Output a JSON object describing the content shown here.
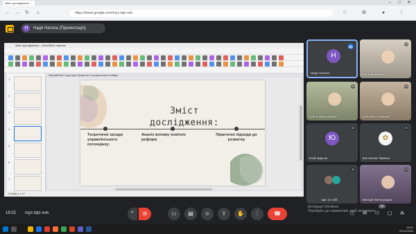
{
  "browser": {
    "tab_title": "Зміст дослідження",
    "url": "https://meet.google.com/myz-tqtz-xvb"
  },
  "meet": {
    "presenter_label": "Надя Нагола (Презентація)",
    "presenter_initial": "Н",
    "meeting_time": "19:02",
    "meeting_code": "myz-tqtz-xvb",
    "people_count": "23"
  },
  "ppt": {
    "window_title": "Зміст дослідження - LibreOffice Impress",
    "notes_tabs": "Звичайний  Структура  Примітки  Сортувальник слайдів",
    "status_text": "Слайд 4 з 12",
    "slide_numbers": [
      "1",
      "2",
      "3",
      "4",
      "5",
      "6",
      "7"
    ]
  },
  "slide": {
    "title": "Зміст дослідження:",
    "items": [
      "Теоретичні засади управлінського потенціалу;",
      "Аналіз впливу освітніх реформ",
      "Практичні підходи до розвитку"
    ]
  },
  "participants": [
    {
      "name": "Надя Нагола",
      "initial": "Н",
      "color": "#7e57c2",
      "type": "avatar",
      "active": true
    },
    {
      "name": "Наталія Василь",
      "type": "photo",
      "bg": "#cfc7b7"
    },
    {
      "name": "Ольга Миколаївна Т",
      "type": "photo",
      "bg": "#a7b08c"
    },
    {
      "name": "Світлана Гнатенко",
      "type": "photo",
      "bg": "#b9a58c"
    },
    {
      "name": "Юлія Брусок",
      "initial": "Ю",
      "color": "#7e57c2",
      "type": "avatar"
    },
    {
      "name": "Костянтин Павлюк",
      "type": "logo"
    },
    {
      "name": "Ще 14 осіб",
      "type": "group"
    },
    {
      "name": "Вікторія Виноградна",
      "type": "photo",
      "bg": "#6c5b7b"
    }
  ],
  "watermark": {
    "line1": "Активація Windows",
    "line2": "Перейдіть до параметрів, щоб активувати"
  },
  "taskbar": {
    "time": "19:02",
    "date": "23.10.2024"
  }
}
